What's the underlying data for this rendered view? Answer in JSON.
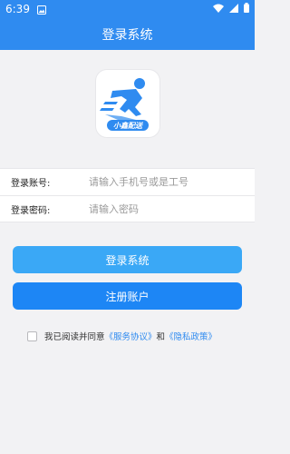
{
  "status_bar": {
    "time": "6:39",
    "left_icon": "gallery-notification-icon",
    "right_icons": [
      "wifi-icon",
      "signal-icon",
      "battery-icon"
    ]
  },
  "header": {
    "title": "登录系统"
  },
  "logo": {
    "text": "小鑫配送",
    "color": "#2f8bf0"
  },
  "form": {
    "account_label": "登录账号:",
    "account_placeholder": "请输入手机号或是工号",
    "password_label": "登录密码:",
    "password_placeholder": "请输入密码"
  },
  "buttons": {
    "login": "登录系统",
    "register": "注册账户"
  },
  "agreement": {
    "prefix": "我已阅读并同意",
    "service_link": "《服务协议》",
    "and": "和",
    "privacy_link": "《隐私政策》"
  },
  "colors": {
    "primary": "#2f8bf0",
    "login_button": "#3aa8f6",
    "register_button": "#1d86f5"
  }
}
